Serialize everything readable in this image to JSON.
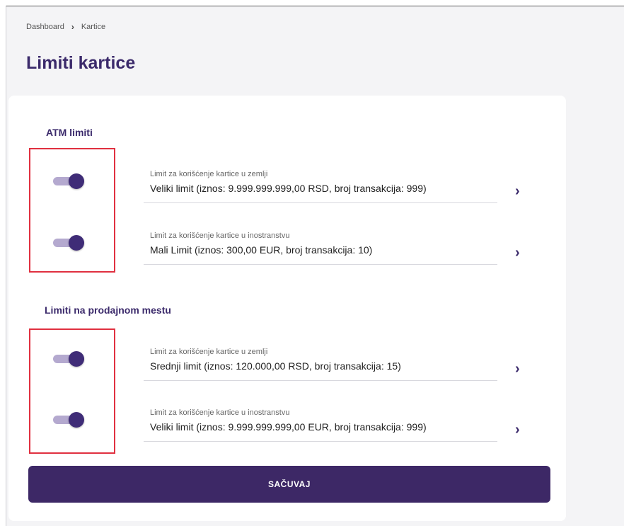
{
  "breadcrumb": {
    "items": [
      "Dashboard",
      "Kartice"
    ],
    "separator": "›"
  },
  "page_title": "Limiti kartice",
  "sections": [
    {
      "title": "ATM limiti",
      "rows": [
        {
          "caption": "Limit za korišćenje kartice u zemlji",
          "value": "Veliki limit (iznos: 9.999.999.999,00 RSD, broj transakcija: 999)",
          "enabled": true
        },
        {
          "caption": "Limit za korišćenje kartice u inostranstvu",
          "value": "Mali Limit (iznos: 300,00 EUR, broj transakcija: 10)",
          "enabled": true
        }
      ]
    },
    {
      "title": "Limiti na prodajnom mestu",
      "rows": [
        {
          "caption": "Limit za korišćenje kartice u zemlji",
          "value": "Srednji limit (iznos: 120.000,00 RSD, broj transakcija: 15)",
          "enabled": true
        },
        {
          "caption": "Limit za korišćenje kartice u inostranstvu",
          "value": "Veliki limit (iznos: 9.999.999.999,00 EUR, broj transakcija: 999)",
          "enabled": true
        }
      ]
    }
  ],
  "save_label": "SAČUVAJ",
  "colors": {
    "accent": "#3b2a6b",
    "toggle_track": "#b4a9cf",
    "toggle_knob": "#3f2c77",
    "button_bg": "#3d2866",
    "highlight": "#e03040"
  },
  "icons": {
    "row_chevron": "chevron-right-icon"
  }
}
